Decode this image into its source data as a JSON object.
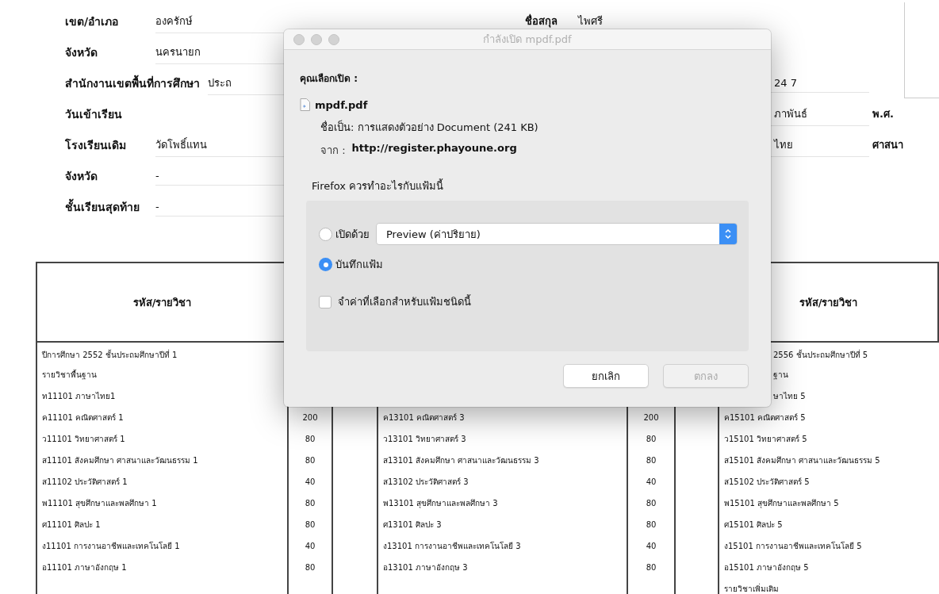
{
  "header_rows": [
    {
      "label": "เขต/อำเภอ",
      "value": "องครักษ์",
      "mid": [
        {
          "kind": "label",
          "text": "ชื่อสกุล"
        },
        {
          "kind": "value",
          "text": "ไพศรี"
        }
      ]
    },
    {
      "label": "จังหวัด",
      "value": "นครนายก"
    },
    {
      "label": "สำนักงานเขตพื้นที่การศึกษา",
      "value": "ประถ",
      "right": [
        {
          "kind": "value",
          "text": "24 7"
        }
      ]
    },
    {
      "label": "วันเข้าเรียน",
      "right": [
        {
          "kind": "value",
          "text": "ภาพันธ์"
        },
        {
          "kind": "label",
          "text": "พ.ศ."
        }
      ]
    },
    {
      "label": "โรงเรียนเดิม",
      "value": "วัดโพธิ์แทน",
      "right": [
        {
          "kind": "value",
          "text": "ไทย"
        },
        {
          "kind": "label",
          "text": "ศาสนา"
        }
      ]
    },
    {
      "label": "จังหวัด",
      "value": "-"
    },
    {
      "label": "ชั้นเรียนสุดท้าย",
      "value": "-"
    }
  ],
  "table": {
    "headings": {
      "left": "รหัส/รายวิชา",
      "right": "รหัส/รายวิชา"
    },
    "rows": [
      {
        "left": {
          "subject": "ปีการศึกษา 2552 ชั้นประถมศึกษาปีที่ 1"
        },
        "right": {
          "subject": "2556 ชั้นประถมศึกษาปีที่ 5",
          "partial": true
        }
      },
      {
        "left": {
          "subject": "รายวิชาพื้นฐาน"
        },
        "right": {
          "subject": "ฐาน",
          "partial": true
        }
      },
      {
        "left": {
          "subject": "ท11101 ภาษาไทย1"
        },
        "right": {
          "subject": "ษาไทย 5",
          "partial": true
        }
      },
      {
        "left": {
          "subject": "ค11101 คณิตศาสตร์ 1",
          "credits": "200"
        },
        "middle": {
          "subject": "ค13101 คณิตศาสตร์ 3",
          "credits": "200"
        },
        "right": {
          "subject": "ค15101 คณิตศาสตร์ 5"
        }
      },
      {
        "left": {
          "subject": "ว11101 วิทยาศาสตร์ 1",
          "credits": "80"
        },
        "middle": {
          "subject": "ว13101 วิทยาศาสตร์ 3",
          "credits": "80"
        },
        "right": {
          "subject": "ว15101 วิทยาศาสตร์ 5"
        }
      },
      {
        "left": {
          "subject": "ส11101 สังคมศึกษา ศาสนาและวัฒนธรรม 1",
          "credits": "80"
        },
        "middle": {
          "subject": "ส13101 สังคมศึกษา ศาสนาและวัฒนธรรม 3",
          "credits": "80"
        },
        "right": {
          "subject": "ส15101 สังคมศึกษา ศาสนาและวัฒนธรรม 5"
        }
      },
      {
        "left": {
          "subject": "ส11102 ประวัติศาสตร์ 1",
          "credits": "40"
        },
        "middle": {
          "subject": "ส13102 ประวัติศาสตร์ 3",
          "credits": "40"
        },
        "right": {
          "subject": "ส15102 ประวัติศาสตร์ 5"
        }
      },
      {
        "left": {
          "subject": "พ11101 สุขศึกษาและพลศึกษา 1",
          "credits": "80"
        },
        "middle": {
          "subject": "พ13101 สุขศึกษาและพลศึกษา 3",
          "credits": "80"
        },
        "right": {
          "subject": "พ15101 สุขศึกษาและพลศึกษา 5"
        }
      },
      {
        "left": {
          "subject": "ศ11101 ศิลปะ 1",
          "credits": "80"
        },
        "middle": {
          "subject": "ศ13101 ศิลปะ 3",
          "credits": "80"
        },
        "right": {
          "subject": "ศ15101 ศิลปะ 5"
        }
      },
      {
        "left": {
          "subject": "ง11101 การงานอาชีพและเทคโนโลยี 1",
          "credits": "40"
        },
        "middle": {
          "subject": "ง13101 การงานอาชีพและเทคโนโลยี 3",
          "credits": "40"
        },
        "right": {
          "subject": "ง15101 การงานอาชีพและเทคโนโลยี 5"
        }
      },
      {
        "left": {
          "subject": "อ11101 ภาษาอังกฤษ 1",
          "credits": "80"
        },
        "middle": {
          "subject": "อ13101 ภาษาอังกฤษ 3",
          "credits": "80"
        },
        "right": {
          "subject": "อ15101 ภาษาอังกฤษ 5"
        }
      },
      {
        "right": {
          "subject": "รายวิชาเพิ่มเติม"
        }
      }
    ]
  },
  "dialog": {
    "title": "กำลังเปิด mpdf.pdf",
    "intro": "คุณเลือกเปิด :",
    "file_name": "mpdf.pdf",
    "type_line": "ชื่อเป็น: การแสดงตัวอย่าง Document (241 KB)",
    "from_label": "จาก :",
    "from_url": "http://register.phayoune.org",
    "question": "Firefox ควรทำอะไรกับแฟ้มนี้",
    "options": [
      {
        "kind": "open_with",
        "label": "เปิดด้วย",
        "selected": false,
        "app": "Preview (ค่าปริยาย)"
      },
      {
        "kind": "save",
        "label": "บันทึกแฟ้ม",
        "selected": true
      }
    ],
    "remember": {
      "label": "จำค่าที่เลือกสำหรับแฟ้มชนิดนี้",
      "checked": false
    },
    "buttons": [
      {
        "label": "ยกเลิก",
        "disabled": false
      },
      {
        "label": "ตกลง",
        "disabled": true
      }
    ]
  }
}
